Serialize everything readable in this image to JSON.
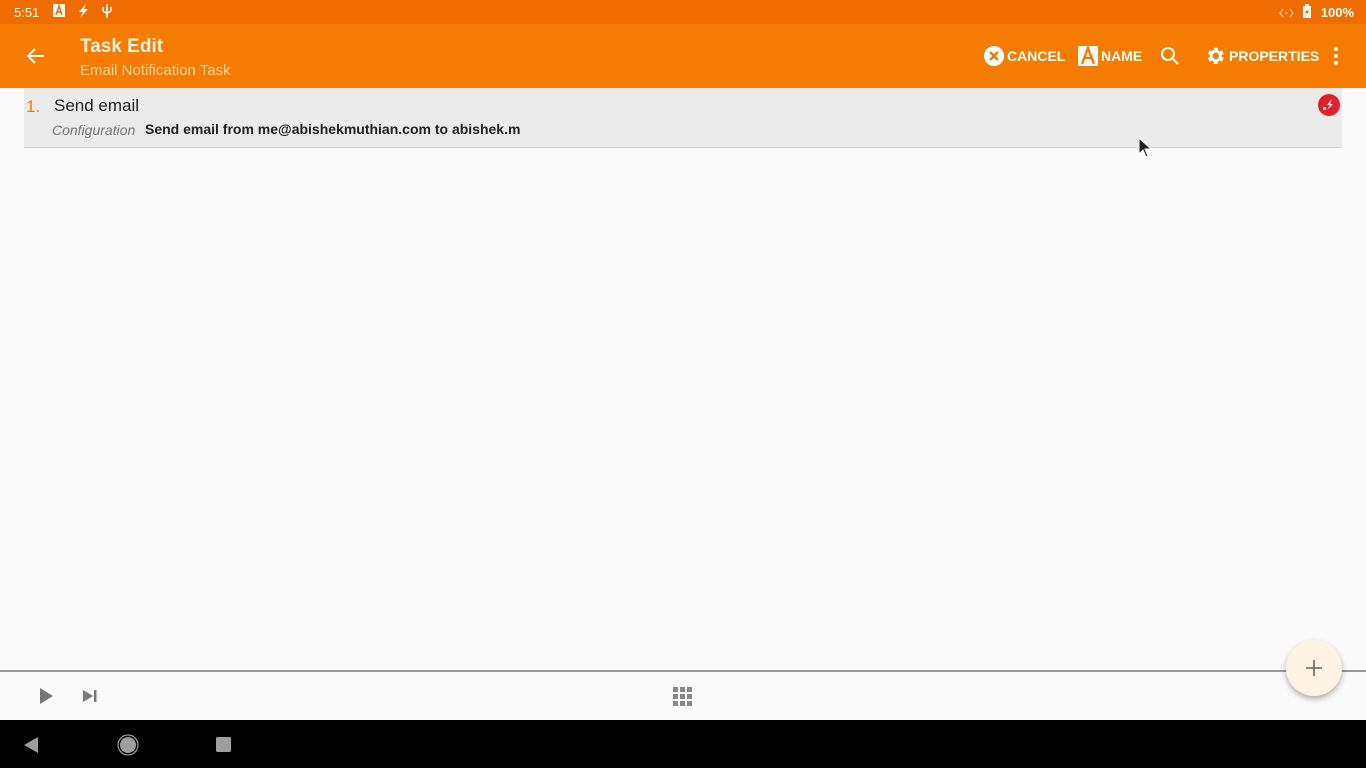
{
  "statusbar": {
    "time": "5:51",
    "battery": "100%",
    "icons": [
      "accessibility-a-icon",
      "flash-icon",
      "usb-icon",
      "data-transfer-icon",
      "battery-charging-icon"
    ]
  },
  "appbar": {
    "title": "Task Edit",
    "subtitle": "Email Notification Task",
    "actions": {
      "cancel": "CANCEL",
      "name": "NAME",
      "properties": "PROPERTIES"
    }
  },
  "actions_list": [
    {
      "number": "1.",
      "name": "Send email",
      "config_label": "Configuration",
      "config_value": "Send email from me@abishekmuthian.com to abishek.m",
      "status_icon": "error-plugin-icon"
    }
  ],
  "colors": {
    "accent": "#f57c00",
    "statusbar": "#ef6c00",
    "error": "#e0202a",
    "fab": "#fff3e3"
  }
}
